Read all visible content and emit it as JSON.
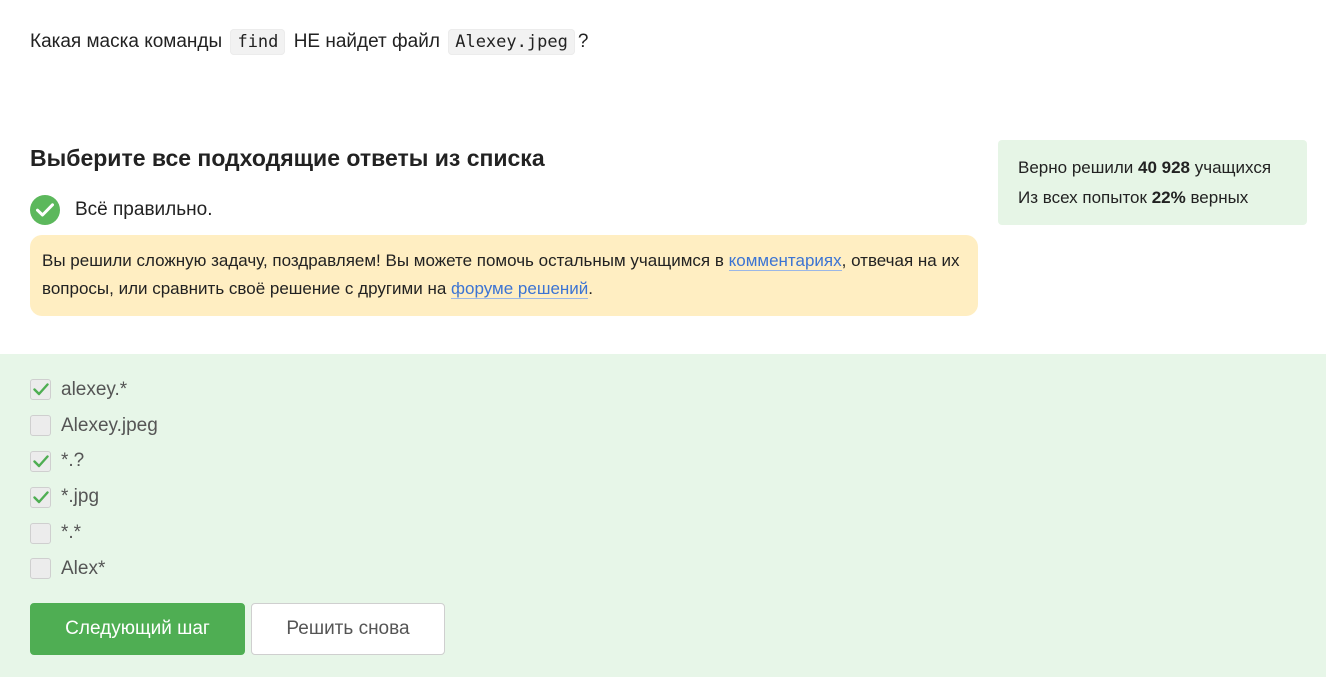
{
  "question": {
    "prefix": "Какая маска команды",
    "command": "find",
    "middle": "НЕ найдет файл",
    "filename": "Alexey.jpeg",
    "suffix": "?"
  },
  "task": {
    "title": "Выберите все подходящие ответы из списка"
  },
  "result": {
    "status_text": "Всё правильно.",
    "status_color": "#5cb85c"
  },
  "hint": {
    "text_1": "Вы решили сложную задачу, поздравляем! Вы можете помочь остальным учащимся в",
    "link_comments": "комментариях",
    "text_2": ", отвечая на их вопросы, или сравнить своё решение с другими на",
    "link_forum": "форуме решений",
    "text_3": "."
  },
  "stats": {
    "solved_prefix": "Верно решили",
    "solved_count": "40 928",
    "solved_suffix": "учащихся",
    "attempts_prefix": "Из всех попыток",
    "attempts_percent": "22%",
    "attempts_suffix": "верных"
  },
  "options": [
    {
      "label": "alexey.*",
      "checked": true
    },
    {
      "label": "Alexey.jpeg",
      "checked": false
    },
    {
      "label": "*.?",
      "checked": true
    },
    {
      "label": "*.jpg",
      "checked": true
    },
    {
      "label": "*.*",
      "checked": false
    },
    {
      "label": "Alex*",
      "checked": false
    }
  ],
  "buttons": {
    "next_label": "Следующий шаг",
    "retry_label": "Решить снова"
  },
  "colors": {
    "accent_green": "#4fae53",
    "link_blue": "#3c74d3",
    "hint_bg": "#ffeec2",
    "answers_bg": "#e7f6e8"
  }
}
